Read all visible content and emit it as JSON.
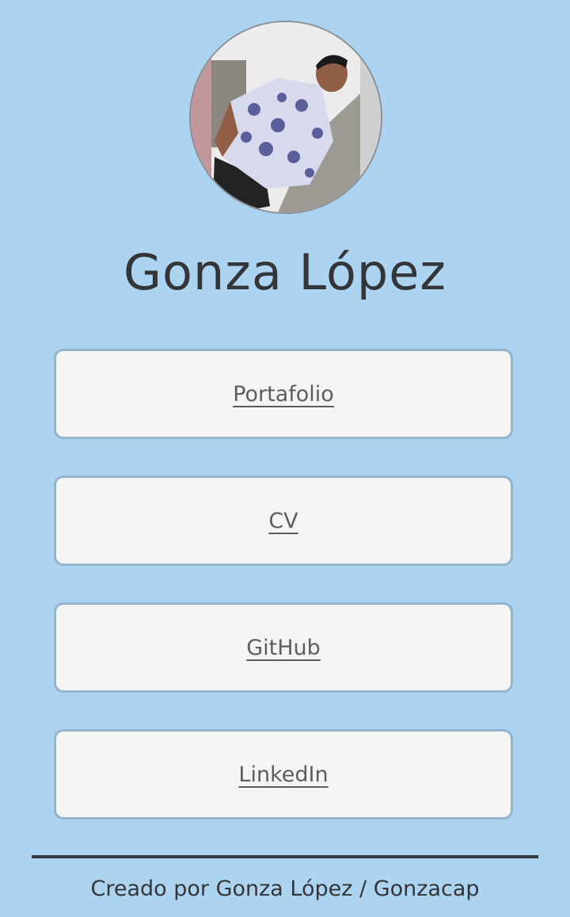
{
  "profile": {
    "name": "Gonza López"
  },
  "links": [
    {
      "label": "Portafolio"
    },
    {
      "label": "CV"
    },
    {
      "label": "GitHub"
    },
    {
      "label": "LinkedIn"
    }
  ],
  "footer": {
    "credit": "Creado por Gonza López / Gonzacap"
  },
  "colors": {
    "background": "#acd4f0",
    "card": "#f4f4f4",
    "card_border": "#93b4cc",
    "text": "#333538"
  }
}
